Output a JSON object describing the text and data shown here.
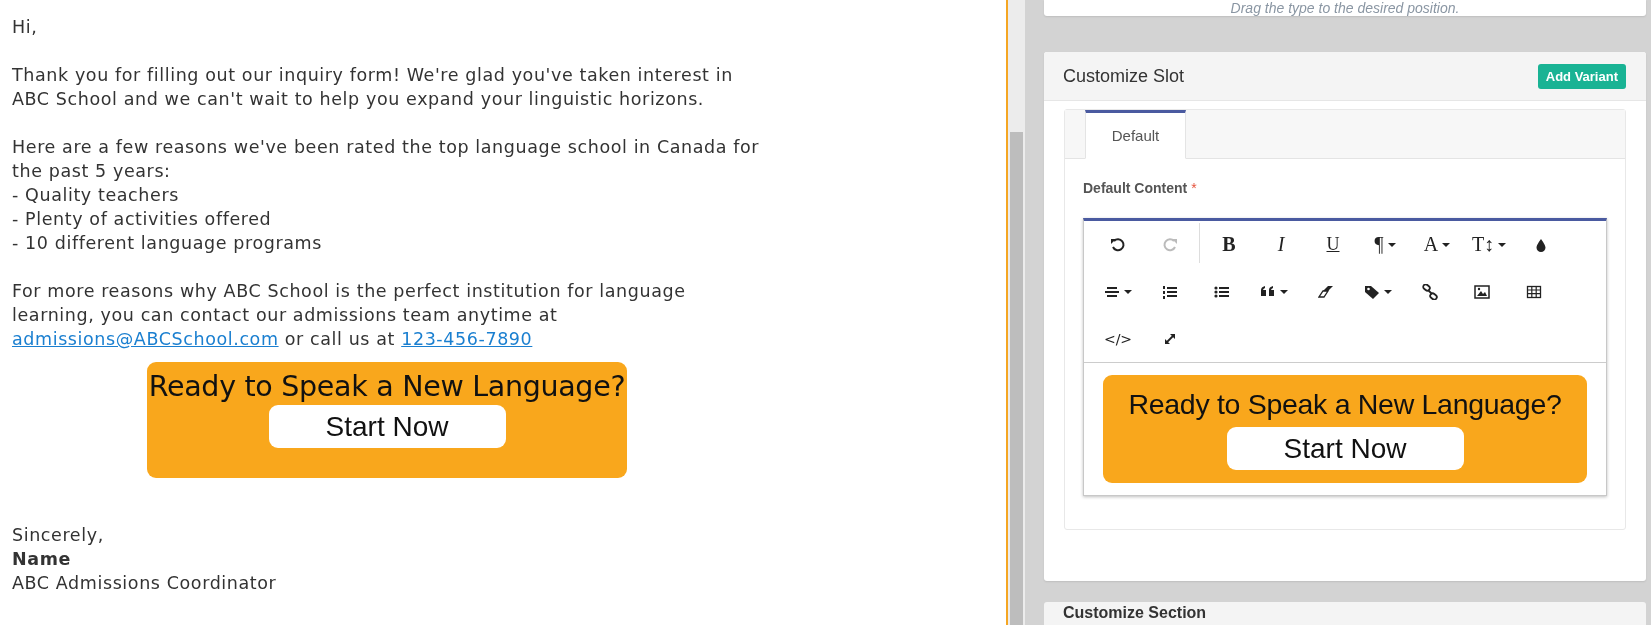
{
  "email": {
    "greeting": "Hi,",
    "intro": "Thank you for filling out our inquiry form! We're glad you've taken interest in ABC School and we can't wait to help you expand your linguistic horizons.",
    "reasons_lead": "Here are a few reasons we've been rated the top language school in Canada for the past 5 years:",
    "reasons": [
      "- Quality teachers",
      "- Plenty of activities offered",
      "- 10 different language programs"
    ],
    "contact": [
      {
        "kind": "text",
        "text": "For more reasons why ABC School is the perfect institution for language learning, you can contact our admissions team anytime at "
      },
      {
        "kind": "link",
        "text": "admissions@ABCSchool.com"
      },
      {
        "kind": "text",
        "text": " or call us at "
      },
      {
        "kind": "link",
        "text": "123-456-7890"
      }
    ],
    "banner": {
      "headline": "Ready to Speak a New Language?",
      "button": "Start Now"
    },
    "closing": "Sincerely,",
    "signer": "Name",
    "signer_title": "ABC Admissions Coordinator"
  },
  "sidebar": {
    "hint": "Drag the type to the desired position.",
    "slot_card": {
      "title": "Customize Slot",
      "add_button": "Add Variant",
      "tabs": [
        {
          "label": "Default",
          "selected": true
        }
      ],
      "field_label": "Default Content",
      "required_mark": "*",
      "toolbar": [
        [
          {
            "kind": "icon",
            "disabled": false,
            "dropdown": false
          },
          {
            "kind": "icon",
            "disabled": true,
            "dropdown": false
          },
          {
            "kind": "separator"
          },
          {
            "kind": "glyph",
            "label": "B",
            "dropdown": false
          },
          {
            "kind": "glyph",
            "label": "I",
            "dropdown": false
          },
          {
            "kind": "glyph",
            "label": "U",
            "dropdown": false
          },
          {
            "kind": "glyph",
            "label": "¶",
            "dropdown": true
          },
          {
            "kind": "glyph",
            "label": "A",
            "dropdown": true
          },
          {
            "kind": "glyph",
            "label": "T↕",
            "dropdown": true
          },
          {
            "kind": "icon",
            "disabled": false,
            "dropdown": false
          }
        ],
        [
          {
            "kind": "icon",
            "disabled": false,
            "dropdown": true
          },
          {
            "kind": "icon",
            "disabled": false,
            "dropdown": false
          },
          {
            "kind": "icon",
            "disabled": false,
            "dropdown": false
          },
          {
            "kind": "icon",
            "disabled": false,
            "dropdown": true
          },
          {
            "kind": "icon",
            "disabled": false,
            "dropdown": false
          },
          {
            "kind": "icon",
            "disabled": false,
            "dropdown": true
          },
          {
            "kind": "icon",
            "disabled": false,
            "dropdown": false
          },
          {
            "kind": "icon",
            "disabled": false,
            "dropdown": false
          },
          {
            "kind": "icon",
            "disabled": false,
            "dropdown": false
          }
        ],
        [
          {
            "kind": "glyph",
            "label": "</>",
            "dropdown": false
          },
          {
            "kind": "icon",
            "disabled": false,
            "dropdown": false
          }
        ]
      ],
      "banner": {
        "headline": "Ready to Speak a New Language?",
        "button": "Start Now"
      }
    },
    "next_card_title": "Customize Section"
  }
}
